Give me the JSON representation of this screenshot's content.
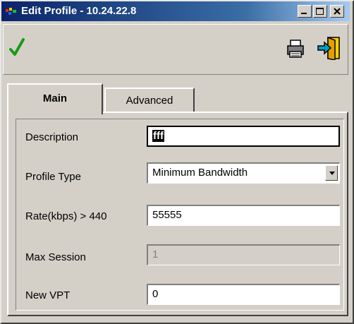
{
  "window": {
    "title": "Edit Profile - 10.24.22.8",
    "icons": {
      "app": "app-icon",
      "minimize": "minimize-icon",
      "maximize": "maximize-icon",
      "close": "close-icon"
    }
  },
  "toolbar": {
    "icons": {
      "apply": "checkmark-icon",
      "print": "printer-icon",
      "exit": "exit-door-icon"
    },
    "colors": {
      "check": "#1a9a1a",
      "exit": "#00a0c0"
    }
  },
  "tabs": [
    {
      "label": "Main",
      "selected": true
    },
    {
      "label": "Advanced",
      "selected": false
    }
  ],
  "form": {
    "description": {
      "label": "Description",
      "value": "fff"
    },
    "profile_type": {
      "label": "Profile Type",
      "value": "Minimum Bandwidth"
    },
    "rate": {
      "label": "Rate(kbps) > 440",
      "value": "55555"
    },
    "max_session": {
      "label": "Max Session",
      "value": "1"
    },
    "new_vpt": {
      "label": "New VPT",
      "value": "0"
    }
  }
}
